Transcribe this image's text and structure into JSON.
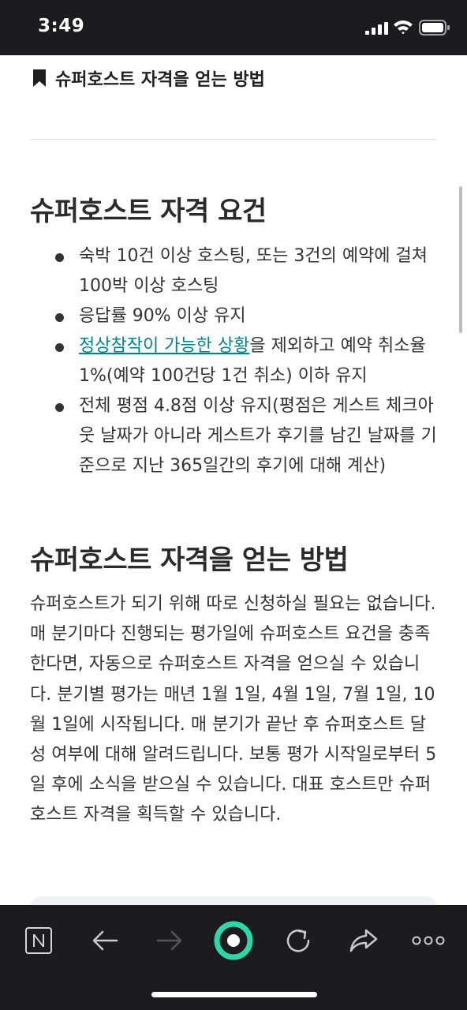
{
  "status_bar": {
    "time": "3:49"
  },
  "bookmark": {
    "title": "슈퍼호스트 자격을 얻는 방법"
  },
  "requirements": {
    "heading": "슈퍼호스트 자격 요건",
    "items": [
      {
        "text": "숙박 10건 이상 호스팅, 또는 3건의 예약에 걸쳐 100박 이상 호스팅"
      },
      {
        "text": "응답률 90% 이상 유지"
      },
      {
        "link": "정상참작이 가능한 상황",
        "text": "을 제외하고 예약 취소율 1%(예약 100건당 1건 취소) 이하 유지"
      },
      {
        "text": "전체 평점 4.8점 이상 유지(평점은 게스트 체크아웃 날짜가 아니라 게스트가 후기를 남긴 날짜를 기준으로 지난 365일간의 후기에 대해 계산)"
      }
    ]
  },
  "how_to": {
    "heading": "슈퍼호스트 자격을 얻는 방법",
    "paragraph": "슈퍼호스트가 되기 위해 따로 신청하실 필요는 없습니다. 매 분기마다 진행되는 평가일에 슈퍼호스트 요건을 충족한다면, 자동으로 슈퍼호스트 자격을 얻으실 수 있습니다. 분기별 평가는 매년 1월 1일, 4월 1일, 7월 1일, 10월 1일에 시작됩니다. 매 분기가 끝난 후 슈퍼호스트 달성 여부에 대해 알려드립니다. 보통 평가 시작일로부터 5일 후에 소식을 받으실 수 있습니다. 대표 호스트만 슈퍼호스트 자격을 획득할 수 있습니다."
  },
  "toolbar": {
    "items": [
      "notion-icon",
      "back-arrow-icon",
      "forward-arrow-icon",
      "home-button-icon",
      "reload-icon",
      "share-icon",
      "more-icon"
    ],
    "accent_color": "#2bd9a8"
  }
}
